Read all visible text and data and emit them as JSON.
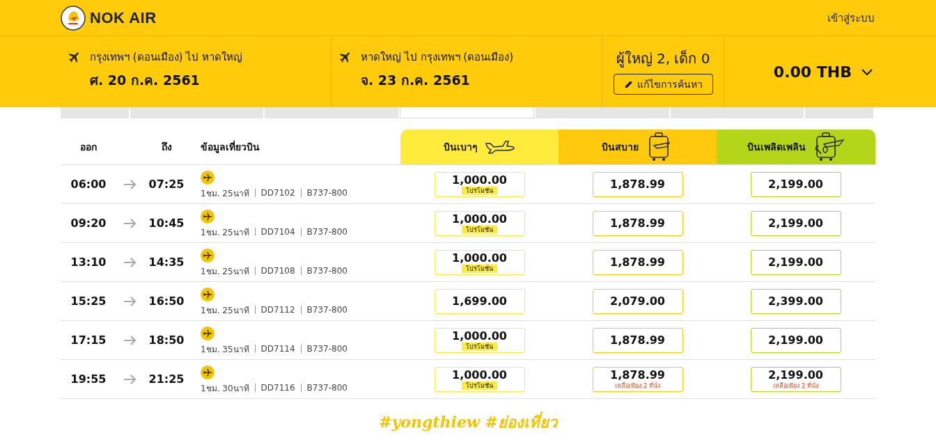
{
  "brand": {
    "name": "NOK AIR"
  },
  "login_link": "เข้าสู่ระบบ",
  "trips": [
    {
      "route": "กรุงเทพฯ (ดอนเมือง) ไป หาดใหญ่",
      "date": "ศ. 20 ก.ค. 2561"
    },
    {
      "route": "หาดใหญ่ ไป กรุงเทพฯ (ดอนเมือง)",
      "date": "จ. 23 ก.ค. 2561"
    }
  ],
  "passengers": {
    "summary": "ผู้ใหญ่ 2, เด็ก 0",
    "edit_button": "แก้ไขการค้นหา"
  },
  "total": {
    "amount": "0.00 THB",
    "expanded": false
  },
  "date_strip": [
    {
      "selected": false
    },
    {
      "selected": false
    },
    {
      "selected": false
    },
    {
      "selected": true
    },
    {
      "selected": false
    },
    {
      "selected": false
    },
    {
      "selected": false
    }
  ],
  "table": {
    "columns": [
      "ออก",
      "ถึง",
      "ข้อมูลเที่ยวบิน"
    ],
    "fare_classes": [
      {
        "label": "บินเบาๆ",
        "kind": "light",
        "color": "#ffeb3b"
      },
      {
        "label": "บินสบาย",
        "kind": "bag",
        "color": "#ffc90e"
      },
      {
        "label": "บินเพลิดเพลิน",
        "kind": "meal",
        "color": "#b5d51b"
      }
    ],
    "rows": [
      {
        "depart": "06:00",
        "arrive": "07:25",
        "duration": "1ชม. 25นาที",
        "flight": "DD7102",
        "aircraft": "B737-800",
        "fares": [
          {
            "price": "1,000.00",
            "promo": "โปรโมชั่น"
          },
          {
            "price": "1,878.99"
          },
          {
            "price": "2,199.00"
          }
        ]
      },
      {
        "depart": "09:20",
        "arrive": "10:45",
        "duration": "1ชม. 25นาที",
        "flight": "DD7104",
        "aircraft": "B737-800",
        "fares": [
          {
            "price": "1,000.00",
            "promo": "โปรโมชั่น"
          },
          {
            "price": "1,878.99"
          },
          {
            "price": "2,199.00"
          }
        ]
      },
      {
        "depart": "13:10",
        "arrive": "14:35",
        "duration": "1ชม. 25นาที",
        "flight": "DD7108",
        "aircraft": "B737-800",
        "fares": [
          {
            "price": "1,000.00",
            "promo": "โปรโมชั่น"
          },
          {
            "price": "1,878.99"
          },
          {
            "price": "2,199.00"
          }
        ]
      },
      {
        "depart": "15:25",
        "arrive": "16:50",
        "duration": "1ชม. 25นาที",
        "flight": "DD7112",
        "aircraft": "B737-800",
        "fares": [
          {
            "price": "1,699.00"
          },
          {
            "price": "2,079.00"
          },
          {
            "price": "2,399.00"
          }
        ]
      },
      {
        "depart": "17:15",
        "arrive": "18:50",
        "duration": "1ชม. 35นาที",
        "flight": "DD7114",
        "aircraft": "B737-800",
        "fares": [
          {
            "price": "1,000.00",
            "promo": "โปรโมชั่น"
          },
          {
            "price": "1,878.99"
          },
          {
            "price": "2,199.00"
          }
        ]
      },
      {
        "depart": "19:55",
        "arrive": "21:25",
        "duration": "1ชม. 30นาที",
        "flight": "DD7116",
        "aircraft": "B737-800",
        "fares": [
          {
            "price": "1,000.00",
            "promo": "โปรโมชั่น"
          },
          {
            "price": "1,878.99",
            "seats_left": "เหลือเพียง 2 ที่นั่ง"
          },
          {
            "price": "2,199.00",
            "seats_left": "เหลือเพียง 2 ที่นั่ง"
          }
        ]
      }
    ]
  },
  "footer_tagline": "#yongthiew #ย่องเที่ยว"
}
